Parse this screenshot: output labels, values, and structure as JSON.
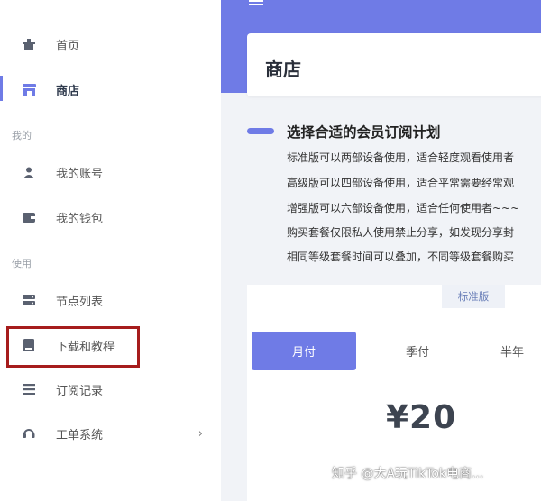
{
  "sidebar": {
    "items": [
      {
        "label": "首页",
        "icon": "home-icon"
      },
      {
        "label": "商店",
        "icon": "store-icon",
        "active": true
      },
      {
        "label": "我的账号",
        "icon": "user-icon"
      },
      {
        "label": "我的钱包",
        "icon": "wallet-icon"
      },
      {
        "label": "节点列表",
        "icon": "server-icon"
      },
      {
        "label": "下载和教程",
        "icon": "book-icon"
      },
      {
        "label": "订阅记录",
        "icon": "list-icon"
      },
      {
        "label": "工单系统",
        "icon": "headset-icon"
      }
    ],
    "sections": [
      "我的",
      "使用"
    ],
    "chevron": "›"
  },
  "page": {
    "title": "商店"
  },
  "announcement": {
    "title": "选择合适的会员订阅计划",
    "lines": [
      "标准版可以两部设备使用，适合轻度观看使用者",
      "高级版可以四部设备使用，适合平常需要经常观",
      "增强版可以六部设备使用，适合任何使用者~~~",
      "购买套餐仅限私人使用禁止分享，如发现分享封",
      "相同等级套餐时间可以叠加，不同等级套餐购买"
    ]
  },
  "pricing": {
    "plan_tab": "标准版",
    "periods": [
      "月付",
      "季付",
      "半年"
    ],
    "price": "¥20"
  },
  "watermark": "知乎 @大A玩TikTok电商...",
  "colors": {
    "accent": "#6f7be6",
    "highlight_border": "#a61c1c"
  }
}
